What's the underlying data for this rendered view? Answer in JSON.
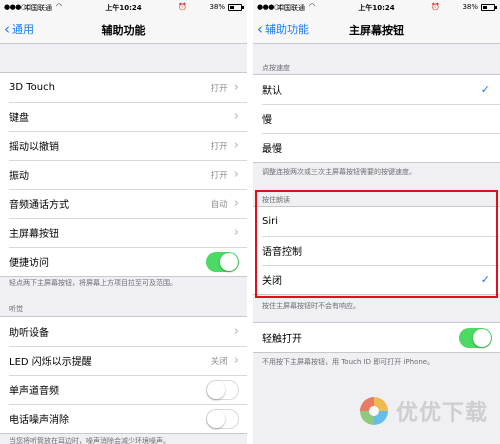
{
  "left": {
    "statusbar": {
      "signal": "●●●○○",
      "carrier": "中国联通",
      "time": "上午10:24",
      "battery_pct": "38%"
    },
    "nav": {
      "back_label": "通用",
      "title": "辅助功能"
    },
    "group1": [
      {
        "label": "3D Touch",
        "value": "打开"
      },
      {
        "label": "键盘",
        "value": ""
      },
      {
        "label": "摇动以撤销",
        "value": "打开"
      },
      {
        "label": "振动",
        "value": "打开"
      },
      {
        "label": "音频通话方式",
        "value": "自动"
      },
      {
        "label": "主屏幕按钮",
        "value": ""
      },
      {
        "label": "便捷访问",
        "toggle": true
      }
    ],
    "footer1": "轻点两下主屏幕按钮，将屏幕上方项目拉至可及范围。",
    "section2_header": "听觉",
    "group2": [
      {
        "label": "助听设备",
        "value": ""
      },
      {
        "label": "LED 闪烁以示提醒",
        "value": "关闭"
      },
      {
        "label": "单声道音频",
        "toggle": false
      },
      {
        "label": "电话噪声消除",
        "toggle": false
      }
    ],
    "footer2": "当您将听筒放在耳边时，噪声消除会减少环境噪声。"
  },
  "right": {
    "statusbar": {
      "signal": "●●●○○",
      "carrier": "中国联通",
      "time": "上午10:24",
      "battery_pct": "38%"
    },
    "nav": {
      "back_label": "辅助功能",
      "title": "主屏幕按钮"
    },
    "section1_header": "点按速度",
    "speed_options": [
      {
        "label": "默认",
        "selected": true
      },
      {
        "label": "慢",
        "selected": false
      },
      {
        "label": "最慢",
        "selected": false
      }
    ],
    "footer1": "调整连按两次或三次主屏幕按钮需要的按键速度。",
    "section2_header": "按住朗读",
    "hold_options": [
      {
        "label": "Siri",
        "selected": false
      },
      {
        "label": "语音控制",
        "selected": false
      },
      {
        "label": "关闭",
        "selected": true
      }
    ],
    "footer2": "按住主屏幕按钮时不会有响应。",
    "rest_finger": {
      "label": "轻触打开",
      "toggle": true
    },
    "footer3": "不用按下主屏幕按钮，用 Touch ID 即可打开 iPhone。"
  },
  "colors": {
    "accent": "#1a7cf5",
    "toggle_on": "#4cd964",
    "highlight": "#e0101a",
    "background": "#efeff4"
  },
  "watermark": {
    "text": "优优下载"
  }
}
